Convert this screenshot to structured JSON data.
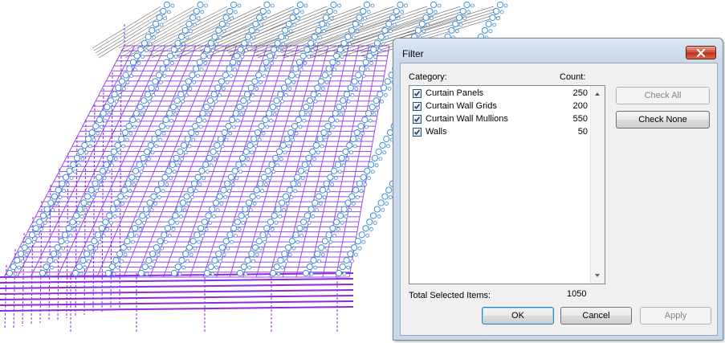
{
  "dialog": {
    "title": "Filter",
    "category_header": "Category:",
    "count_header": "Count:",
    "items": [
      {
        "name": "Curtain Panels",
        "count": "250",
        "checked": true
      },
      {
        "name": "Curtain Wall Grids",
        "count": "200",
        "checked": true
      },
      {
        "name": "Curtain Wall Mullions",
        "count": "550",
        "checked": true
      },
      {
        "name": "Walls",
        "count": "50",
        "checked": true
      }
    ],
    "total_label": "Total Selected Items:",
    "total_value": "1050",
    "buttons": {
      "check_all": "Check All",
      "check_none": "Check None",
      "ok": "OK",
      "cancel": "Cancel",
      "apply": "Apply"
    }
  },
  "colors": {
    "wall_purple": "#8a2be2",
    "mullion_blue": "#3a8fd6",
    "grid_gray": "#5a5a5a"
  },
  "icons": {
    "close": "close-x-icon",
    "checkbox": "checkmark-icon",
    "scroll_up": "triangle-up-icon",
    "scroll_down": "triangle-down-icon"
  }
}
